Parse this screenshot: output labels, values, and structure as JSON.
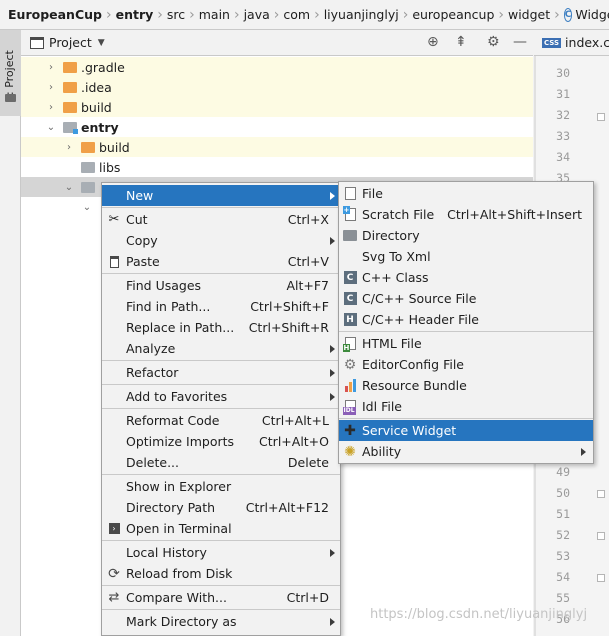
{
  "breadcrumb": [
    "EuropeanCup",
    "entry",
    "src",
    "main",
    "java",
    "com",
    "liyuanjinglyj",
    "europeancup",
    "widget",
    "WidgetA"
  ],
  "tool_strip": {
    "label": "1: Project"
  },
  "project_panel": {
    "title": "Project",
    "tree": [
      {
        "label": ".gradle",
        "folder": "orange",
        "expanded": false,
        "highlighted": true
      },
      {
        "label": ".idea",
        "folder": "orange",
        "expanded": false,
        "highlighted": true
      },
      {
        "label": "build",
        "folder": "orange",
        "expanded": false,
        "highlighted": true
      },
      {
        "label": "entry",
        "folder": "entry",
        "expanded": true,
        "bold": true
      },
      {
        "label": "build",
        "folder": "orange",
        "expanded": false,
        "highlighted": true
      },
      {
        "label": "libs",
        "folder": "gray",
        "expanded": null
      },
      {
        "label": "",
        "folder": "gray",
        "expanded": true,
        "selected": true
      },
      {
        "label": "",
        "folder": "none",
        "expanded": true
      }
    ]
  },
  "editor": {
    "tab_label": "index.css",
    "tab_badge": "CSS",
    "line_numbers": [
      "30",
      "31",
      "32",
      "33",
      "34",
      "35",
      "49",
      "50",
      "51",
      "52",
      "53",
      "54",
      "55",
      "56"
    ]
  },
  "context_menu": {
    "items": [
      {
        "label": "New",
        "shortcut": "",
        "submenu": true,
        "active": true,
        "icon": ""
      },
      {
        "label": "Cut",
        "shortcut": "Ctrl+X",
        "icon": "scissors-icon"
      },
      {
        "label": "Copy",
        "shortcut": "",
        "submenu": true,
        "icon": ""
      },
      {
        "label": "Paste",
        "shortcut": "Ctrl+V",
        "icon": "clipboard-icon"
      },
      {
        "label": "Find Usages",
        "shortcut": "Alt+F7",
        "icon": ""
      },
      {
        "label": "Find in Path...",
        "shortcut": "Ctrl+Shift+F",
        "icon": ""
      },
      {
        "label": "Replace in Path...",
        "shortcut": "Ctrl+Shift+R",
        "icon": ""
      },
      {
        "label": "Analyze",
        "shortcut": "",
        "submenu": true,
        "icon": ""
      },
      {
        "label": "Refactor",
        "shortcut": "",
        "submenu": true,
        "icon": ""
      },
      {
        "label": "Add to Favorites",
        "shortcut": "",
        "submenu": true,
        "icon": ""
      },
      {
        "label": "Reformat Code",
        "shortcut": "Ctrl+Alt+L",
        "icon": ""
      },
      {
        "label": "Optimize Imports",
        "shortcut": "Ctrl+Alt+O",
        "icon": ""
      },
      {
        "label": "Delete...",
        "shortcut": "Delete",
        "icon": ""
      },
      {
        "label": "Show in Explorer",
        "shortcut": "",
        "icon": ""
      },
      {
        "label": "Directory Path",
        "shortcut": "Ctrl+Alt+F12",
        "icon": ""
      },
      {
        "label": "Open in Terminal",
        "shortcut": "",
        "icon": "terminal-icon"
      },
      {
        "label": "Local History",
        "shortcut": "",
        "submenu": true,
        "icon": ""
      },
      {
        "label": "Reload from Disk",
        "shortcut": "",
        "icon": "reload-icon"
      },
      {
        "label": "Compare With...",
        "shortcut": "Ctrl+D",
        "icon": "compare-icon"
      },
      {
        "label": "Mark Directory as",
        "shortcut": "",
        "submenu": true,
        "icon": ""
      }
    ]
  },
  "new_submenu": {
    "items": [
      {
        "label": "File",
        "shortcut": "",
        "icon": "file-icon"
      },
      {
        "label": "Scratch File",
        "shortcut": "Ctrl+Alt+Shift+Insert",
        "icon": "scratch-file-icon"
      },
      {
        "label": "Directory",
        "shortcut": "",
        "icon": "folder-icon"
      },
      {
        "label": "Svg To Xml",
        "shortcut": "",
        "icon": ""
      },
      {
        "label": "C++ Class",
        "shortcut": "",
        "icon": "cpp-class-icon"
      },
      {
        "label": "C/C++ Source File",
        "shortcut": "",
        "icon": "c-source-icon"
      },
      {
        "label": "C/C++ Header File",
        "shortcut": "",
        "icon": "c-header-icon"
      },
      {
        "label": "HTML File",
        "shortcut": "",
        "icon": "html-file-icon"
      },
      {
        "label": "EditorConfig File",
        "shortcut": "",
        "icon": "gear-icon"
      },
      {
        "label": "Resource Bundle",
        "shortcut": "",
        "icon": "resource-bundle-icon"
      },
      {
        "label": "Idl File",
        "shortcut": "",
        "icon": "idl-file-icon"
      },
      {
        "label": "Service Widget",
        "shortcut": "",
        "icon": "puzzle-icon",
        "active": true
      },
      {
        "label": "Ability",
        "shortcut": "",
        "icon": "ability-icon",
        "submenu": true
      }
    ]
  },
  "watermark": "https://blog.csdn.net/liyuanjinglyj",
  "colors": {
    "accent": "#2675bf",
    "highlight_row": "#fdfbe3",
    "folder_orange": "#f0a048"
  }
}
